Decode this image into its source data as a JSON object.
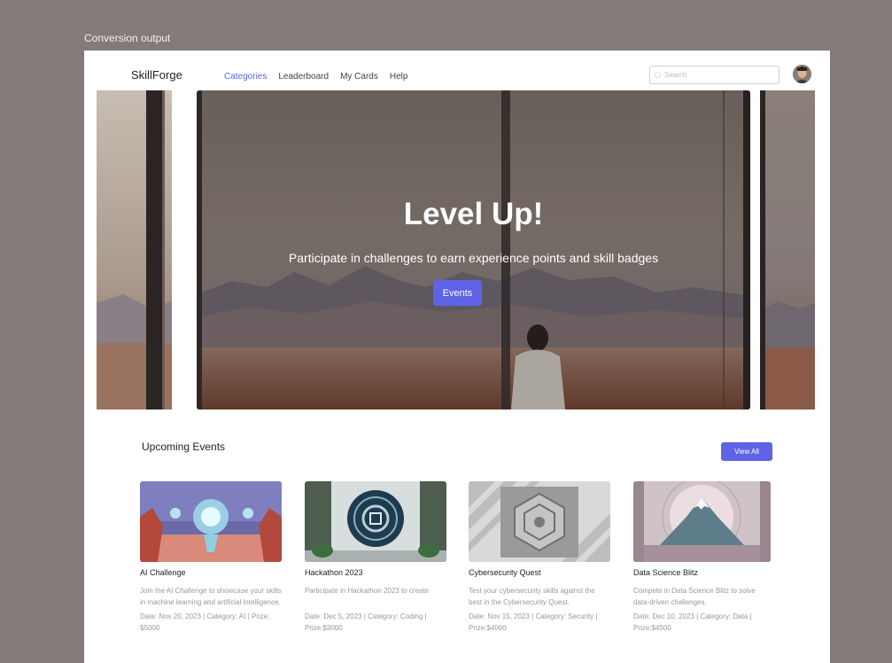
{
  "caption": "Conversion output",
  "nav": {
    "brand": "SkillForge",
    "links": [
      {
        "label": "Categories",
        "active": true
      },
      {
        "label": "Leaderboard",
        "active": false
      },
      {
        "label": "My Cards",
        "active": false
      },
      {
        "label": "Help",
        "active": false
      }
    ],
    "search_placeholder": "Search"
  },
  "hero": {
    "title": "Level Up!",
    "subtitle": "Participate in challenges to earn experience points and skill badges",
    "button": "Events"
  },
  "events": {
    "title": "Upcoming Events",
    "view_all": "View All",
    "items": [
      {
        "title": "AI Challenge",
        "desc": "Join the AI Challenge to showcase your skills in machine learning and artificial intelligence.",
        "meta": "Date: Nov 20, 2023 | Category: AI | Prize: $5000"
      },
      {
        "title": "Hackathon 2023",
        "desc": "Participate in Hackathon 2023 to create",
        "meta": "Date: Dec 5, 2023 | Category: Coding | Prize:$3000"
      },
      {
        "title": "Cybersecurity Quest",
        "desc": "Test your cybersecurity skills against the best in the Cybersecurity Quest.",
        "meta": "Date: Nov 15, 2023 | Category: Security | Prize:$4000"
      },
      {
        "title": "Data Science Blitz",
        "desc": "Compete in Data Science Blitz to solve data-driven challenges.",
        "meta": "Date: Dec 10, 2023 | Category: Data | Prize:$4500"
      }
    ]
  }
}
